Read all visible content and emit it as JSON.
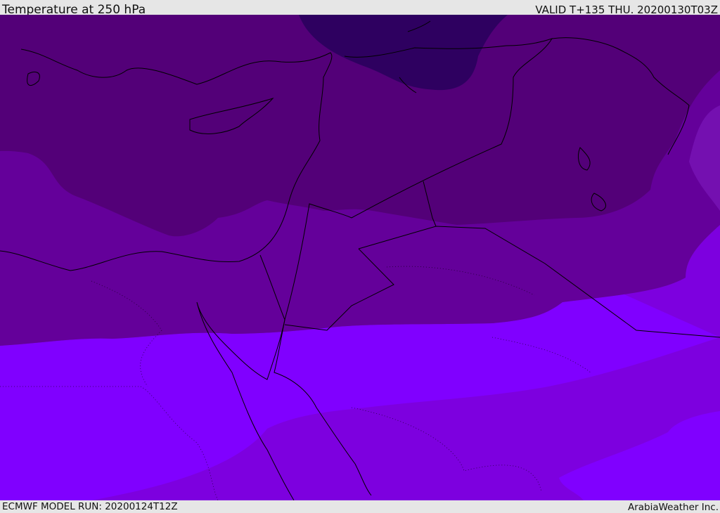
{
  "header": {
    "title": "Temperature at 250 hPa",
    "valid": "VALID T+135 THU. 20200130T03Z"
  },
  "footer": {
    "model_run": "ECMWF MODEL RUN: 20200124T12Z",
    "brand": "ArabiaWeather Inc."
  },
  "map": {
    "field": "temperature-250hPa",
    "colors": {
      "band1": "#2e0060",
      "band2": "#530078",
      "band3": "#64009a",
      "band4": "#7410b0",
      "band5": "#7d00df",
      "band6": "#8000ff",
      "coast": "#000000"
    }
  }
}
